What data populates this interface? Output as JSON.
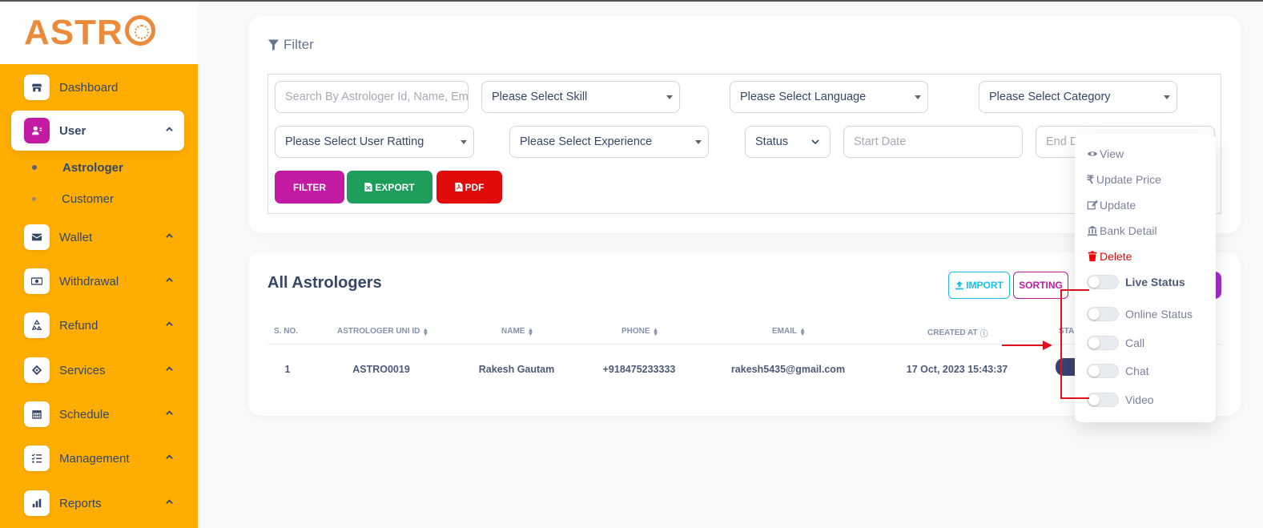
{
  "brand": {
    "logo_text": "ASTR",
    "accent": "#ffad01",
    "logo_color": "#ec8a3c"
  },
  "sidebar": {
    "items": [
      {
        "label": "Dashboard",
        "icon": "store-icon"
      },
      {
        "label": "User",
        "icon": "user-icon",
        "active": true
      },
      {
        "label": "Wallet",
        "icon": "wallet-icon"
      },
      {
        "label": "Withdrawal",
        "icon": "money-icon"
      },
      {
        "label": "Refund",
        "icon": "recycle-icon"
      },
      {
        "label": "Services",
        "icon": "layers-icon"
      },
      {
        "label": "Schedule",
        "icon": "calendar-icon"
      },
      {
        "label": "Management",
        "icon": "checklist-icon"
      },
      {
        "label": "Reports",
        "icon": "chart-icon"
      }
    ],
    "sub_items": [
      {
        "label": "Astrologer",
        "active": true
      },
      {
        "label": "Customer"
      }
    ]
  },
  "filter": {
    "title": "Filter",
    "search_placeholder": "Search By Astrologer Id, Name, Em",
    "skill": "Please Select Skill",
    "language": "Please Select Language",
    "category": "Please Select Category",
    "rating": "Please Select User Ratting",
    "experience": "Please Select Experience",
    "status": "Status",
    "start_date": "Start Date",
    "end_date": "End D",
    "buttons": {
      "filter": "FILTER",
      "export": "EXPORT",
      "pdf": "PDF"
    }
  },
  "list": {
    "title": "All Astrologers",
    "import_label": "IMPORT",
    "sorting_label": "SORTING",
    "columns": [
      "S. NO.",
      "ASTROLOGER UNI ID",
      "NAME",
      "PHONE",
      "EMAIL",
      "CREATED AT",
      "STA"
    ],
    "rows": [
      {
        "sno": "1",
        "uni_id": "ASTRO0019",
        "name": "Rakesh Gautam",
        "phone": "+918475233333",
        "email": "rakesh5435@gmail.com",
        "created_at": "17 Oct, 2023 15:43:37"
      }
    ]
  },
  "dropdown": {
    "actions": [
      {
        "label": "View",
        "icon": "eye-icon"
      },
      {
        "label": "Update Price",
        "icon": "rupee-icon"
      },
      {
        "label": "Update",
        "icon": "edit-icon"
      },
      {
        "label": "Bank Detail",
        "icon": "bank-icon"
      },
      {
        "label": "Delete",
        "icon": "trash-icon"
      }
    ],
    "toggles": [
      {
        "label": "Live Status",
        "on": false
      },
      {
        "label": "Online Status",
        "on": false
      },
      {
        "label": "Call",
        "on": false
      },
      {
        "label": "Chat",
        "on": false
      },
      {
        "label": "Video",
        "on": false
      }
    ]
  }
}
